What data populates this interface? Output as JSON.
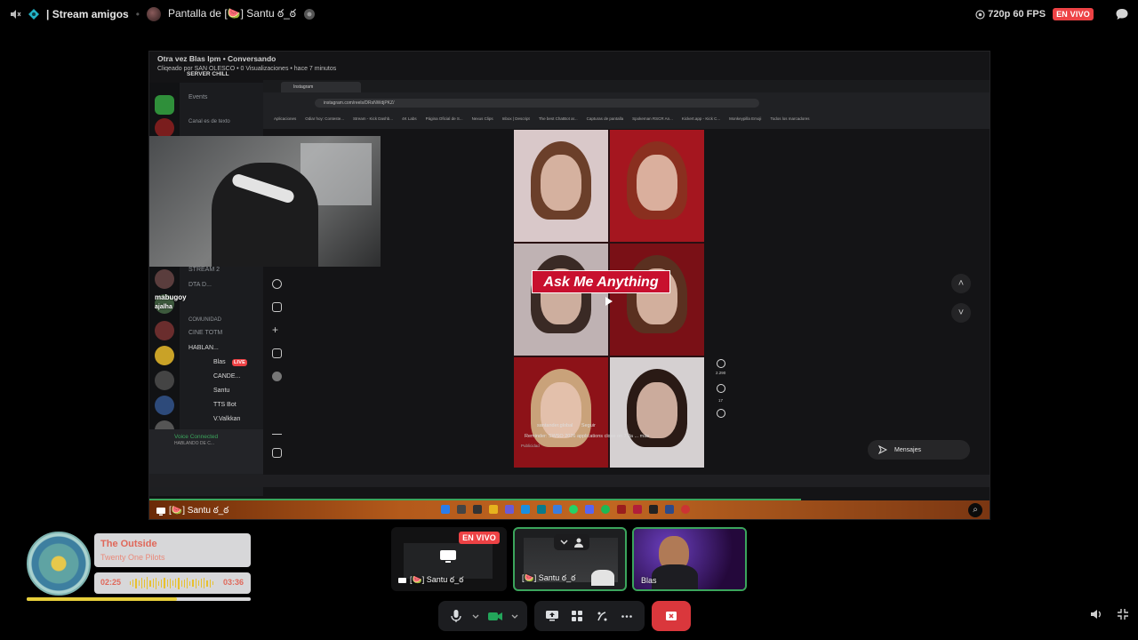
{
  "topbar": {
    "channel_name": "| Stream amigos",
    "screen_label": "Pantalla de [🍉] Santu ఠ_ఠ",
    "quality": "720p 60 FPS",
    "live_badge": "EN VIVO"
  },
  "stream": {
    "title": "Otra vez Blas lpm • Conversando",
    "subtitle": "Cliqeado por SAN OLESCO • 0 Visualizaciones • hace 7 minutos",
    "discord": {
      "server": "SERVER CHILL",
      "events": "Events",
      "category": "Canal es de texto",
      "channels": [
        "STREAM 2",
        "DTA D...",
        "COMUNIDAD",
        "CINE TOTM",
        "HABLAN..."
      ],
      "voice_users": [
        "Blas",
        "CANDE...",
        "Santu",
        "TTS Bot",
        "V.Valkkan"
      ],
      "voice_connected": "Voice Connected",
      "voice_sub": "HABLANDO DE C...",
      "live_tag": "LIVE"
    },
    "chat_overlay": [
      "mabugoy",
      "ajalha"
    ],
    "browser": {
      "tab": "Instagram",
      "url": "instagram.com/reels/DRsNWdjPKZ/",
      "bookmarks": [
        "Aplicaciones",
        "Odiar hoy: Conteste...",
        "Stream - Kick Dashb...",
        "4K Labs",
        "Página Oficial de S...",
        "Nexus Clips",
        "Inbox | Descript",
        "The best ChatBot ar...",
        "Capturas de pantalla",
        "Spokeman RSCR An...",
        "Kickert.app - Kick C...",
        "Monkeypilla Emoji",
        "Todos los marcadores"
      ]
    },
    "reel": {
      "headline": "Ask Me Anything",
      "account": "santander.global",
      "follow": "Seguir",
      "caption": "Reminder: SWSO 2026 applications close on 7 Ja ... más",
      "tag": "Publicidad",
      "likes": "2.290",
      "comments": "17"
    },
    "messages_label": "Mensajes",
    "bottom_label": "[🍉] Santu ఠ_ఠ"
  },
  "music": {
    "title": "The Outside",
    "artist": "Twenty One Pilots",
    "elapsed": "02:25",
    "total": "03:36",
    "progress": 0.67
  },
  "tiles": [
    {
      "label": "[🍉] Santu ఠ_ఠ",
      "live": "EN VIVO"
    },
    {
      "label": "[🍉] Santu ఠ_ఠ"
    },
    {
      "label": "Blas"
    }
  ],
  "colors": {
    "live_red": "#ed4245",
    "speaking_green": "#3ba55c",
    "end_call": "#da373c",
    "music_accent": "#e0685a",
    "music_bar": "#e7cf3a"
  },
  "icons": [
    "speaker-muted-icon",
    "channel-icon",
    "eye-icon",
    "chat-bubble-icon",
    "microphone-icon",
    "camera-icon",
    "screen-share-icon",
    "activities-icon",
    "soundboard-icon",
    "more-icon",
    "leave-call-icon",
    "volume-icon",
    "exit-fullscreen-icon",
    "zoom-icon"
  ]
}
